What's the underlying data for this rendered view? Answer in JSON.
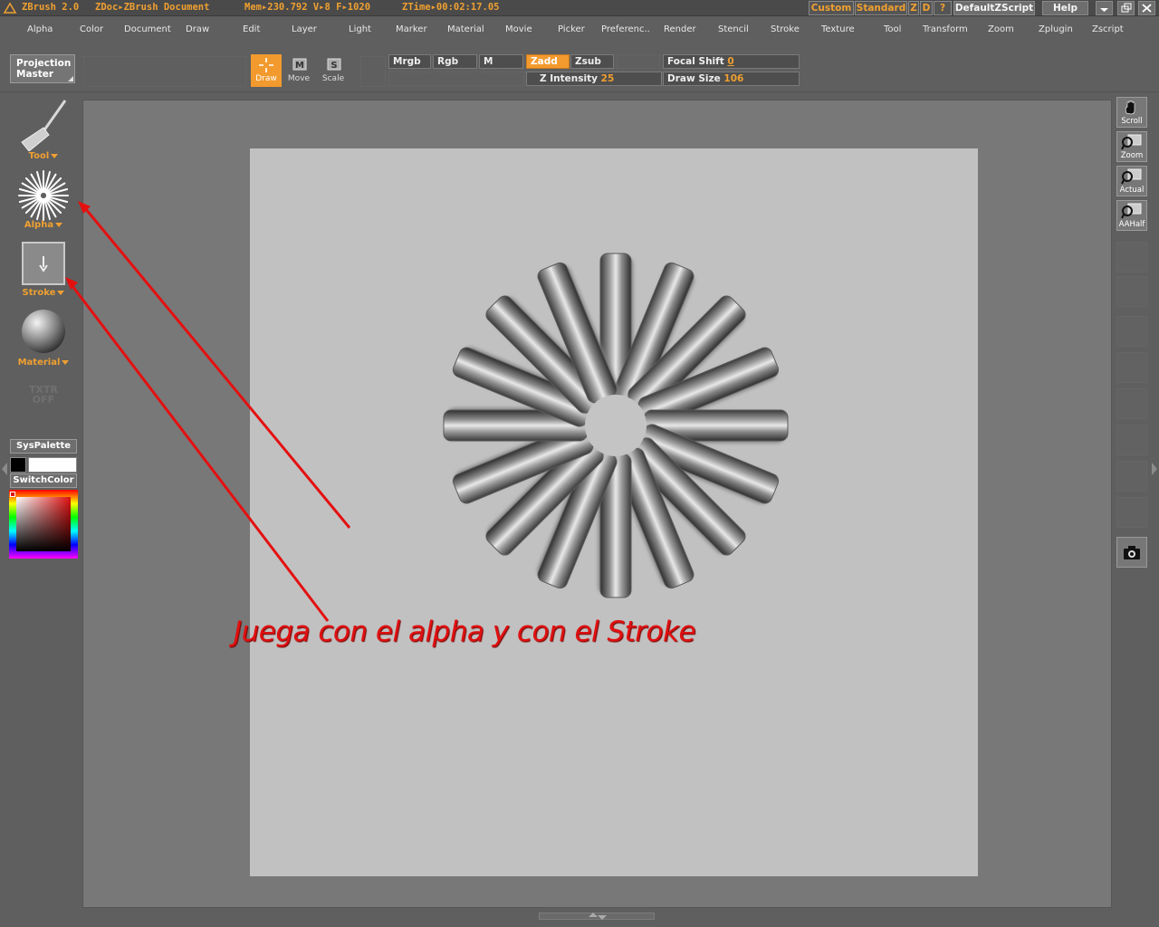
{
  "titlebar": {
    "app": "ZBrush 2.0",
    "doc": "ZDoc▸ZBrush Document",
    "mem": "Mem▸230.792 V▸8 F▸1020",
    "ztime": "ZTime▸00:02:17.05",
    "buttons": {
      "custom": "Custom",
      "standard": "Standard",
      "z": "Z",
      "d": "D",
      "q": "?",
      "script": "DefaultZScript",
      "help": "Help"
    }
  },
  "menu": [
    "Alpha",
    "Color",
    "Document",
    "Draw",
    "Edit",
    "Layer",
    "Light",
    "Marker",
    "Material",
    "Movie",
    "Picker",
    "Preferenc..",
    "Render",
    "Stencil",
    "Stroke",
    "Texture",
    "Tool",
    "Transform",
    "Zoom",
    "Zplugin",
    "Zscript"
  ],
  "toolbar": {
    "projection_master_line1": "Projection",
    "projection_master_line2": "Master",
    "draw": "Draw",
    "move": "Move",
    "scale": "Scale",
    "mrgb": "Mrgb",
    "rgb": "Rgb",
    "m": "M",
    "zadd": "Zadd",
    "zsub": "Zsub",
    "focal_shift_label": "Focal Shift",
    "focal_shift_value": "0",
    "z_intensity_label": "Z Intensity",
    "z_intensity_value": "25",
    "draw_size_label": "Draw Size",
    "draw_size_value": "106"
  },
  "leftpanel": {
    "tool": "Tool",
    "alpha": "Alpha",
    "stroke": "Stroke",
    "material": "Material",
    "txtr_line1": "TXTR",
    "txtr_line2": "OFF",
    "syspalette": "SysPalette",
    "switchcolor": "SwitchColor"
  },
  "rightpanel": {
    "scroll": "Scroll",
    "zoom": "Zoom",
    "actual": "Actual",
    "aahalf": "AAHalf"
  },
  "annotation": "Juega con el alpha y con el Stroke",
  "colors": {
    "accent": "#f29a2e",
    "annotation": "#e01010",
    "canvas": "#c1c1c1"
  }
}
